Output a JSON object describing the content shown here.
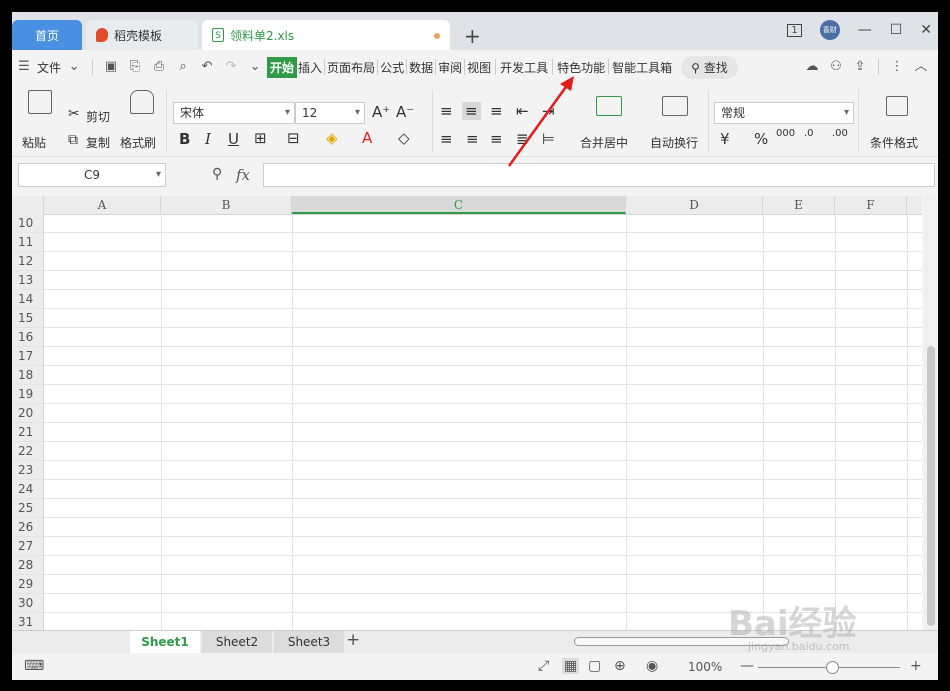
{
  "tabs": {
    "home": "首页",
    "docer": "稻壳模板",
    "file": "领料单2.xls",
    "new_tab": "+"
  },
  "window": {
    "badge": "1",
    "user": "喜财"
  },
  "menu": {
    "file": "文件",
    "items": [
      "开始",
      "插入",
      "页面布局",
      "公式",
      "数据",
      "审阅",
      "视图",
      "开发工具",
      "特色功能",
      "智能工具箱"
    ],
    "active_index": 0,
    "search": "查找"
  },
  "ribbon": {
    "paste": "粘贴",
    "cut": "剪切",
    "copy": "复制",
    "format_painter": "格式刷",
    "font_name": "宋体",
    "font_size": "12",
    "bold": "B",
    "italic": "I",
    "underline": "U",
    "merge_center": "合并居中",
    "wrap_text": "自动换行",
    "number_format": "常规",
    "currency": "¥",
    "percent": "%",
    "conditional_format": "条件格式"
  },
  "formula_bar": {
    "cell_ref": "C9",
    "fx": "fx",
    "formula": ""
  },
  "grid": {
    "columns": [
      "A",
      "B",
      "C",
      "D",
      "E",
      "F"
    ],
    "selected_column": "C",
    "rows": [
      "10",
      "11",
      "12",
      "13",
      "14",
      "15",
      "16",
      "17",
      "18",
      "19",
      "20",
      "21",
      "22",
      "23",
      "24",
      "25",
      "26",
      "27",
      "28",
      "29",
      "30",
      "31"
    ]
  },
  "sheets": {
    "tabs": [
      "Sheet1",
      "Sheet2",
      "Sheet3"
    ],
    "active": "Sheet1",
    "add": "+"
  },
  "status": {
    "zoom": "100%"
  },
  "watermark": {
    "text": "Bai经验",
    "sub": "jingyan.baidu.com"
  },
  "colors": {
    "accent": "#2f9a47",
    "home_tab": "#4a90e2",
    "arrow": "#e31b1b"
  }
}
